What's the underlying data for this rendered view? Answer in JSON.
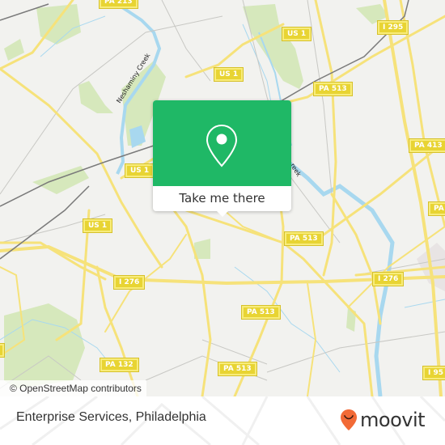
{
  "map": {
    "attribution": "© OpenStreetMap contributors",
    "creek_label": "Neshaminy Creek",
    "creek_label_partial": "reek",
    "colors": {
      "land": "#f2f2ef",
      "park": "#d6e8bc",
      "water": "#a8d8ef",
      "road": "#f6e27a",
      "road_casing": "#e6cf55",
      "rail": "#7a7a7a",
      "shield": "#e8d433"
    },
    "shields": [
      {
        "label": "PA 213"
      },
      {
        "label": "US 1"
      },
      {
        "label": "I 295"
      },
      {
        "label": "PA 513"
      },
      {
        "label": "PA 413"
      },
      {
        "label": "US 1"
      },
      {
        "label": "US 1"
      },
      {
        "label": "PA 513"
      },
      {
        "label": "US 1"
      },
      {
        "label": "I 276"
      },
      {
        "label": "I 276"
      },
      {
        "label": "PA 513"
      },
      {
        "label": "PA 132"
      },
      {
        "label": "PA 513"
      },
      {
        "label": "I 95"
      },
      {
        "label": "PA"
      },
      {
        "label": "PA"
      }
    ]
  },
  "popup": {
    "icon": "map-pin-icon",
    "action_label": "Take me there",
    "accent_color": "#1fb866"
  },
  "footer": {
    "place_name": "Enterprise Services, Philadelphia",
    "brand": "moovit",
    "brand_icon": "moovit-smiley-pin-icon",
    "brand_color": "#f26a36"
  }
}
